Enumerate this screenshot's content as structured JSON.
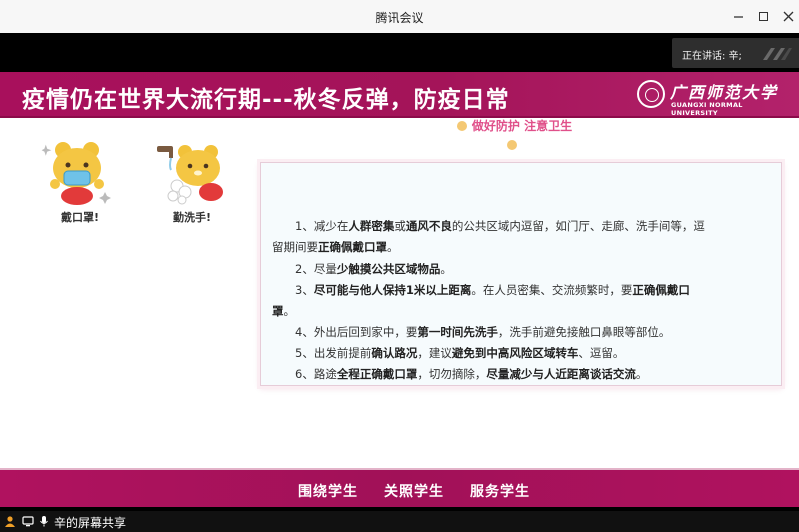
{
  "window": {
    "title": "腾讯会议",
    "minimize_icon": "minimize-icon",
    "maximize_icon": "maximize-icon",
    "close_icon": "close-icon"
  },
  "meeting": {
    "speaking_label": "正在讲话: 辛;",
    "share_label": "辛的屏幕共享"
  },
  "slide": {
    "headline": "疫情仍在世界大流行期---秋冬反弹，防疫日常",
    "university_cn": "广西师范大学",
    "university_en": "GUANGXI NORMAL UNIVERSITY",
    "bear_captions": [
      "戴口罩!",
      "勤洗手!"
    ],
    "card_title": "做好防护 注意卫生",
    "lines": [
      [
        "1、减少在",
        "人群密集",
        "或",
        "通风不良",
        "的公共区域内逗留，如门厅、走廊、洗手间等，逗"
      ],
      [
        "留期间要",
        "正确佩戴口罩",
        "。",
        "",
        ""
      ],
      [
        "2、尽量",
        "少触摸公共区域物品",
        "。",
        "",
        ""
      ],
      [
        "3、",
        "尽可能与他人保持1米以上距离",
        "。在人员密集、交流频繁时，要",
        "正确佩戴口",
        ""
      ],
      [
        "罩",
        "",
        "。",
        "",
        ""
      ],
      [
        "4、外出后回到家中，要",
        "第一时间先洗手",
        "，洗手前避免接触口鼻眼等部位。",
        "",
        ""
      ],
      [
        "5、出发前提前",
        "确认路况",
        "，建议",
        "避免到中高风险区域转车",
        "、逗留。"
      ],
      [
        "6、路途",
        "全程正确戴口罩",
        "，切勿摘除，",
        "尽量减少与人近距离谈话交流",
        "。"
      ]
    ],
    "footer_items": [
      "围绕学生",
      "关照学生",
      "服务学生"
    ]
  },
  "colors": {
    "banner": "#a8105c",
    "footer": "#a11158",
    "card_title": "#e0508a",
    "card_bg": "#f6fbfd"
  }
}
